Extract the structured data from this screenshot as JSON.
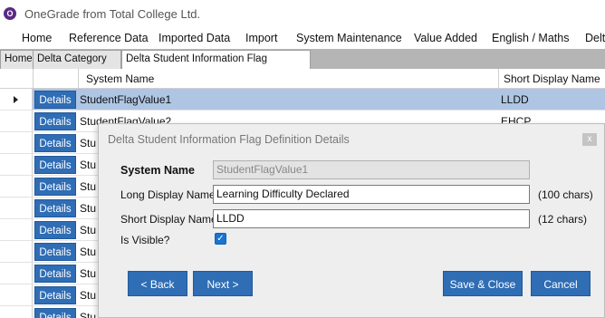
{
  "app": {
    "title": "OneGrade from Total College Ltd.",
    "icon_letter": "O"
  },
  "menu": {
    "items": [
      "Home",
      "Reference Data",
      "Imported Data",
      "Import",
      "System Maintenance",
      "Value Added",
      "English / Maths",
      "Delta"
    ]
  },
  "tabs": {
    "items": [
      "Home",
      "Delta Category",
      "Delta Student Information Flag Definition"
    ],
    "active_index": 2
  },
  "grid": {
    "columns": [
      "System Name",
      "Short Display Name"
    ],
    "details_label": "Details",
    "rows": [
      {
        "system_name": "StudentFlagValue1",
        "short_name": "LLDD",
        "selected": true
      },
      {
        "system_name": "StudentFlagValue2",
        "short_name": "EHCP"
      },
      {
        "system_name": "Stu",
        "short_name": ""
      },
      {
        "system_name": "Stu",
        "short_name": ""
      },
      {
        "system_name": "Stu",
        "short_name": ""
      },
      {
        "system_name": "Stu",
        "short_name": ""
      },
      {
        "system_name": "Stu",
        "short_name": ""
      },
      {
        "system_name": "Stu",
        "short_name": ""
      },
      {
        "system_name": "Stu",
        "short_name": ""
      },
      {
        "system_name": "Stu",
        "short_name": ""
      },
      {
        "system_name": "Stu",
        "short_name": ""
      }
    ]
  },
  "dialog": {
    "title": "Delta Student Information Flag Definition Details",
    "close_label": "x",
    "system_name_label": "System Name",
    "system_name_value": "StudentFlagValue1",
    "long_name_label": "Long Display Name",
    "long_name_value": "Learning Difficulty Declared",
    "long_name_hint": "(100 chars)",
    "short_name_label": "Short Display Name",
    "short_name_value": "LLDD",
    "short_name_hint": "(12 chars)",
    "visible_label": "Is Visible?",
    "visible_checked": true,
    "back_label": "< Back",
    "next_label": "Next >",
    "save_label": "Save & Close",
    "cancel_label": "Cancel"
  }
}
